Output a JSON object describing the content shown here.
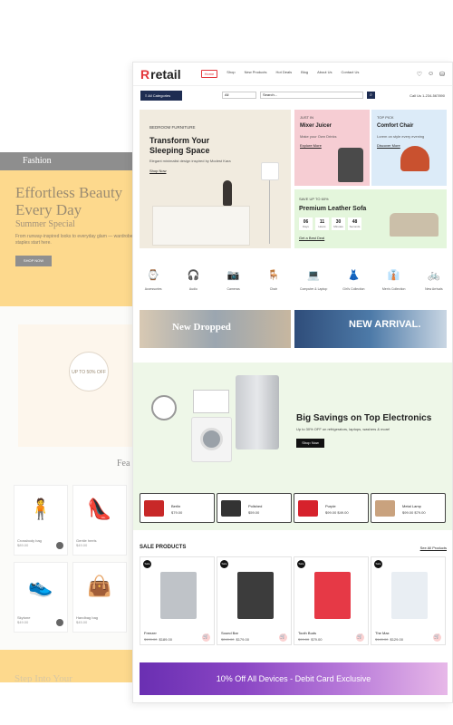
{
  "fashion": {
    "brand": "Fashion",
    "hero_title": "Effortless Beauty Every Day",
    "hero_subtitle": "Summer Special",
    "hero_desc": "From runway-inspired looks to everyday glam — wardrobe staples start here.",
    "hero_button": "SHOP NOW",
    "badge_text": "UP TO 50% OFF",
    "featured_heading": "Fea",
    "products": [
      {
        "name": "Crossbody bag",
        "price": "$89.00"
      },
      {
        "name": "Gentle heels",
        "price": "$49.00"
      },
      {
        "name": "Skytone",
        "price": "$49.00"
      },
      {
        "name": "Handbag bag",
        "price": "$45.00"
      }
    ],
    "footer_heading": "Step Into Your"
  },
  "retail": {
    "logo": "retail",
    "nav": [
      "Home",
      "Shop",
      "New Products",
      "Hot Deals",
      "Blog",
      "About Us",
      "Contact Us"
    ],
    "all_categories": "All Categories",
    "all_select": "All",
    "search_placeholder": "Search...",
    "call_text": "Call Us 1-234-567890",
    "hero": {
      "kicker": "BEDROOM FURNITURE",
      "title_line1": "Transform Your",
      "title_line2": "Sleeping Space",
      "desc": "Elegant minimalist design inspired by Modest Kara",
      "link": "Shop Now"
    },
    "tiles": [
      {
        "kicker": "JUST IN",
        "title": "Mixer Juicer",
        "desc": "Make your Own Drinks",
        "link": "Explore More"
      },
      {
        "kicker": "TOP PICK",
        "title": "Comfort Chair",
        "desc": "Lorem on style every evening",
        "link": "Discover More"
      }
    ],
    "sofa": {
      "kicker": "SAVE UP TO 60%",
      "title": "Premium Leather Sofa",
      "timer": [
        {
          "n": "06",
          "l": "Days"
        },
        {
          "n": "11",
          "l": "Hours"
        },
        {
          "n": "30",
          "l": "Minutes"
        },
        {
          "n": "48",
          "l": "Seconds"
        }
      ],
      "link": "Get a Best Deal"
    },
    "categories": [
      {
        "label": "Accessories",
        "icon": "watch-icon"
      },
      {
        "label": "Audio",
        "icon": "headphones-icon"
      },
      {
        "label": "Cameras",
        "icon": "camera-icon"
      },
      {
        "label": "Chair",
        "icon": "chair-icon"
      },
      {
        "label": "Computer & Laptop",
        "icon": "laptop-icon"
      },
      {
        "label": "Girl's Collection",
        "icon": "dress-icon"
      },
      {
        "label": "Men's Collection",
        "icon": "shirt-icon"
      },
      {
        "label": "New Arrivals",
        "icon": "bike-icon"
      }
    ],
    "promos": [
      {
        "text": "New Dropped"
      },
      {
        "text": "NEW ARRIVAL."
      }
    ],
    "big": {
      "title": "Big Savings on Top Electronics",
      "desc": "Up to 30% OFF on refrigerators, laptops, washers & more!",
      "button": "Shop Now"
    },
    "mini_products": [
      {
        "name": "Berlin",
        "price": "$79.00",
        "color": "#c82828"
      },
      {
        "name": "Polished",
        "price": "$59.00",
        "color": "#333333"
      },
      {
        "name": "Purple",
        "price": "$99.00  $49.00",
        "color": "#d6222c"
      },
      {
        "name": "Metal Lamp",
        "price": "$99.00  $79.00",
        "color": "#c9a27e"
      }
    ],
    "sale_heading": "SALE PRODUCTS",
    "sale_all": "See All Products",
    "sale_products": [
      {
        "name": "Freezer",
        "old": "$199.00",
        "price": "$189.00",
        "color": "#bfc3c8"
      },
      {
        "name": "Sound Bar",
        "old": "$249.00",
        "price": "$179.00",
        "color": "#3c3c3c"
      },
      {
        "name": "Tooth Buds",
        "old": "$99.00",
        "price": "$79.00",
        "color": "#e63946"
      },
      {
        "name": "The Max",
        "old": "$149.00",
        "price": "$129.00",
        "color": "#e9eef3"
      }
    ],
    "sale_badge": "Sale",
    "banner": "10% Off All Devices - Debit Card Exclusive"
  }
}
